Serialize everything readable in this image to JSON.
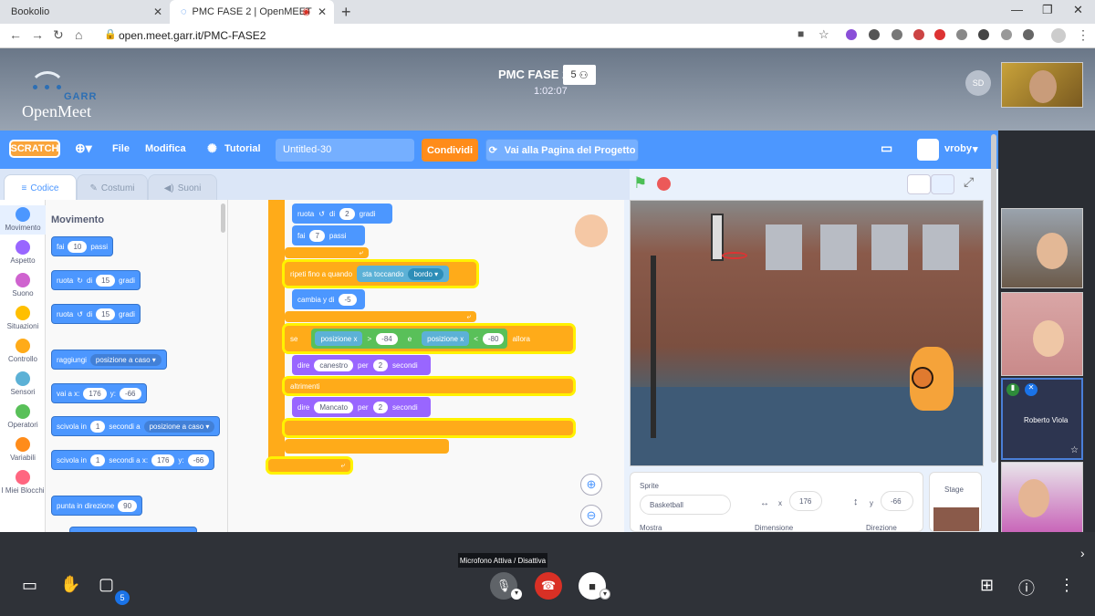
{
  "browser": {
    "tabs": [
      {
        "label": "Bookolio"
      },
      {
        "label": "PMC FASE 2 | OpenMEET"
      }
    ],
    "url": "open.meet.garr.it/PMC-FASE2"
  },
  "meet": {
    "logo_garr": "GARR",
    "logo_name": "OpenMeet",
    "title": "PMC FASE 2",
    "participants": "5",
    "timer": "1:02:07",
    "avatar_initials": "SD",
    "participant_name": "Roberto Viola",
    "tooltip": "Microfono Attiva / Disattiva",
    "chat_badge": "5"
  },
  "scratch": {
    "logo": "SCRATCH",
    "menu": {
      "file": "File",
      "edit": "Modifica",
      "tutorial": "Tutorial"
    },
    "project_title": "Untitled-30",
    "share": "Condividi",
    "project_page": "Vai alla Pagina del Progetto",
    "username": "vroby",
    "tabs": {
      "code": "Codice",
      "costumes": "Costumi",
      "sounds": "Suoni"
    },
    "categories": [
      {
        "label": "Movimento",
        "color": "#4c97ff"
      },
      {
        "label": "Aspetto",
        "color": "#9966ff"
      },
      {
        "label": "Suono",
        "color": "#cf63cf"
      },
      {
        "label": "Situazioni",
        "color": "#ffbf00"
      },
      {
        "label": "Controllo",
        "color": "#ffab19"
      },
      {
        "label": "Sensori",
        "color": "#5cb1d6"
      },
      {
        "label": "Operatori",
        "color": "#59c059"
      },
      {
        "label": "Variabili",
        "color": "#ff8c1a"
      },
      {
        "label": "I Miei Blocchi",
        "color": "#ff6680"
      }
    ],
    "palette": {
      "title": "Movimento",
      "b1": {
        "a": "fai",
        "n": "10",
        "b": "passi"
      },
      "b2": {
        "a": "ruota",
        "b": "di",
        "n": "15",
        "c": "gradi"
      },
      "b3": {
        "a": "ruota",
        "b": "di",
        "n": "15",
        "c": "gradi"
      },
      "b4": {
        "a": "raggiungi",
        "d": "posizione a caso"
      },
      "b5": {
        "a": "vai a x:",
        "x": "176",
        "b": "y:",
        "y": "-66"
      },
      "b6": {
        "a": "scivola in",
        "n": "1",
        "b": "secondi a",
        "d": "posizione a caso"
      },
      "b7": {
        "a": "scivola in",
        "n": "1",
        "b": "secondi a x:",
        "x": "176",
        "c": "y:",
        "y": "-66"
      },
      "b8": {
        "a": "punta in direzione",
        "n": "90"
      }
    },
    "script": {
      "s1": {
        "a": "ruota",
        "b": "di",
        "n": "2",
        "c": "gradi"
      },
      "s2": {
        "a": "fai",
        "n": "7",
        "b": "passi"
      },
      "s3": {
        "a": "ripeti fino a quando",
        "b": "sta toccando",
        "d": "bordo"
      },
      "s4": {
        "a": "cambia y di",
        "n": "-5"
      },
      "s5": {
        "a": "se",
        "p1": "posizione x",
        "gt": ">",
        "v1": "-84",
        "and": "e",
        "p2": "posizione x",
        "lt": "<",
        "v2": "-80",
        "then": "allora"
      },
      "s6": {
        "a": "dire",
        "t": "canestro",
        "b": "per",
        "n": "2",
        "c": "secondi"
      },
      "s7": {
        "a": "altrimenti"
      },
      "s8": {
        "a": "dire",
        "t": "Mancato",
        "b": "per",
        "n": "2",
        "c": "secondi"
      }
    },
    "sprite": {
      "label": "Sprite",
      "name": "Basketball",
      "x_label": "x",
      "x": "176",
      "y_label": "y",
      "y": "-66",
      "show": "Mostra",
      "size": "Dimensione",
      "direction": "Direzione",
      "stage": "Stage"
    }
  }
}
